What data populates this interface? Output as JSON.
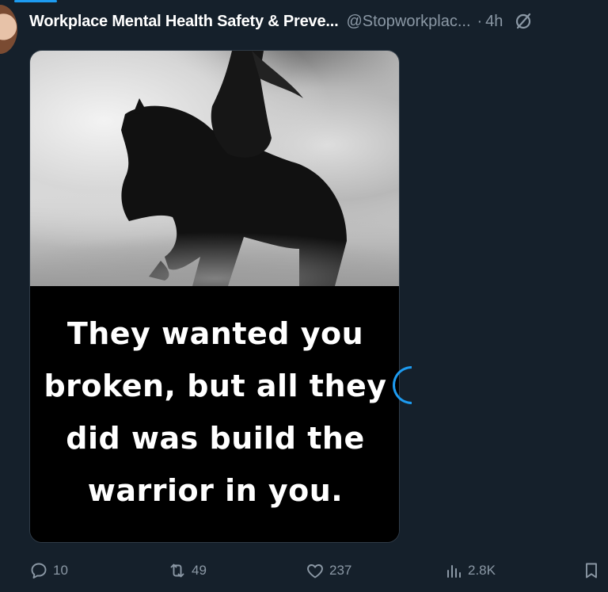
{
  "post": {
    "author_name": "Workplace Mental Health Safety & Preve...",
    "handle": "@Stopworkplac...",
    "separator": "·",
    "time": "4h",
    "quote_lines": [
      "They wanted you",
      "broken, but all they",
      "did was build the",
      "warrior in you."
    ]
  },
  "actions": {
    "replies": "10",
    "reposts": "49",
    "likes": "237",
    "views": "2.8K"
  },
  "icons": {
    "grok": "slash-circle-icon",
    "reply": "reply-icon",
    "repost": "repost-icon",
    "like": "heart-icon",
    "views": "analytics-icon",
    "bookmark": "bookmark-icon"
  },
  "colors": {
    "background": "#15202b",
    "text_muted": "#8b98a5",
    "accent": "#1d9bf0"
  }
}
